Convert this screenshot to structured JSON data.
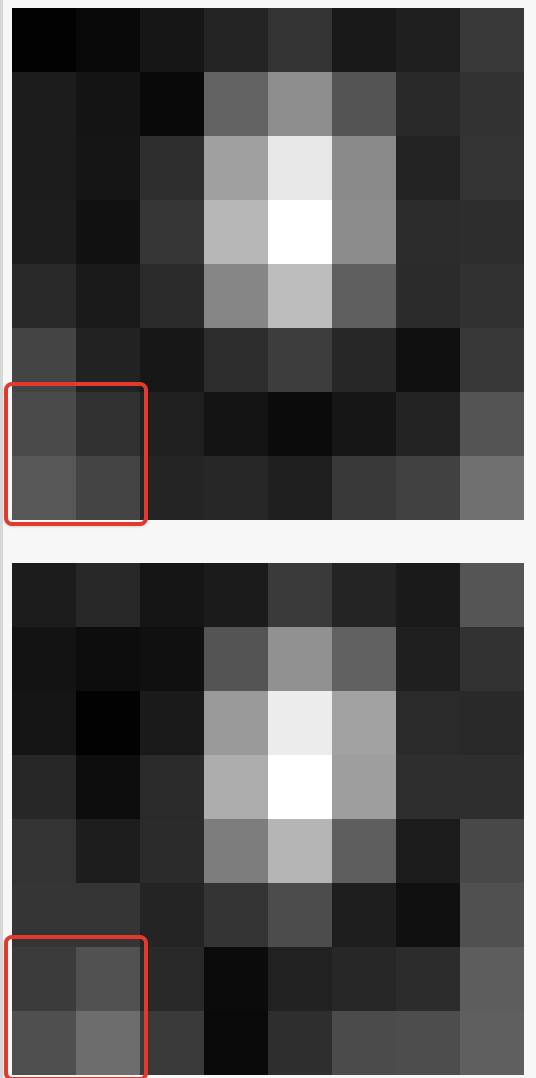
{
  "accent_color": "#e23a2e",
  "images": [
    {
      "pixels": [
        [
          "#020202",
          "#090909",
          "#161616",
          "#242424",
          "#333333",
          "#181818",
          "#1f1f1f",
          "#393939"
        ],
        [
          "#1c1c1c",
          "#141414",
          "#090909",
          "#636363",
          "#8e8e8e",
          "#545454",
          "#292929",
          "#323232"
        ],
        [
          "#1c1c1c",
          "#151515",
          "#2e2e2e",
          "#a0a0a0",
          "#e7e7e7",
          "#8a8a8a",
          "#232323",
          "#333333"
        ],
        [
          "#1d1d1d",
          "#111111",
          "#363636",
          "#b7b7b7",
          "#ffffff",
          "#8c8c8c",
          "#2c2c2c",
          "#2d2d2d"
        ],
        [
          "#292929",
          "#1a1a1a",
          "#2a2a2a",
          "#868686",
          "#bdbdbd",
          "#5f5f5f",
          "#2b2b2b",
          "#313131"
        ],
        [
          "#444444",
          "#222222",
          "#171717",
          "#2d2d2d",
          "#3d3d3d",
          "#272727",
          "#101010",
          "#383838"
        ],
        [
          "#4a4a4a",
          "#313131",
          "#202020",
          "#141414",
          "#0b0b0b",
          "#161616",
          "#232323",
          "#545454"
        ],
        [
          "#575757",
          "#444444",
          "#242424",
          "#272727",
          "#1f1f1f",
          "#393939",
          "#414141",
          "#707070"
        ]
      ]
    },
    {
      "pixels": [
        [
          "#1c1c1c",
          "#282828",
          "#151515",
          "#1b1b1b",
          "#3a3a3a",
          "#242424",
          "#1a1a1a",
          "#555555"
        ],
        [
          "#131313",
          "#0d0d0d",
          "#101010",
          "#545454",
          "#919191",
          "#616161",
          "#1f1f1f",
          "#323232"
        ],
        [
          "#151515",
          "#020202",
          "#1a1a1a",
          "#9a9a9a",
          "#ececec",
          "#a2a2a2",
          "#2a2a2a",
          "#292929"
        ],
        [
          "#272727",
          "#0d0d0d",
          "#2a2a2a",
          "#adadad",
          "#ffffff",
          "#9e9e9e",
          "#2e2e2e",
          "#2e2e2e"
        ],
        [
          "#333333",
          "#1d1d1d",
          "#2b2b2b",
          "#7d7d7d",
          "#b5b5b5",
          "#5e5e5e",
          "#1c1c1c",
          "#484848"
        ],
        [
          "#353535",
          "#353535",
          "#242424",
          "#343434",
          "#4c4c4c",
          "#1e1e1e",
          "#101010",
          "#505050"
        ],
        [
          "#3b3b3b",
          "#515151",
          "#292929",
          "#0b0b0b",
          "#212121",
          "#272727",
          "#2c2c2c",
          "#5d5d5d"
        ],
        [
          "#4f4f4f",
          "#6d6d6d",
          "#3a3a3a",
          "#0a0a0a",
          "#2e2e2e",
          "#4b4b4b",
          "#4d4d4d",
          "#5f5f5f"
        ]
      ]
    }
  ]
}
